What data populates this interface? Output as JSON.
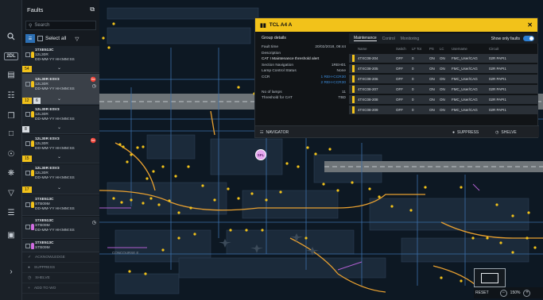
{
  "faults_panel": {
    "title": "Faults",
    "search_placeholder": "Search",
    "select_all_label": "Select all",
    "items": [
      {
        "title": "1TXE513C",
        "line2": "12L30R",
        "line3": "DD-MM-YY HH:MM:SS",
        "count": "54",
        "lamp": "#f2c21a"
      },
      {
        "title": "12L30R ESV3",
        "line2": "12L30R",
        "line3": "DD-MM-YY HH:MM:SS",
        "count": "12",
        "count2": "6",
        "lamp": "#f2c21a"
      },
      {
        "title": "12L30R ESV3",
        "line2": "12L30R",
        "line3": "DD-MM-YY HH:MM:SS",
        "count": "8",
        "lamp": "#f2c21a"
      },
      {
        "title": "12L30R ESV3",
        "line2": "12L30R",
        "line3": "DD-MM-YY HH:MM:SS",
        "count": "15",
        "lamp": "#f2c21a"
      },
      {
        "title": "12L30R ESV3",
        "line2": "12L30R",
        "line3": "DD-MM-YY HH:MM:SS",
        "count": "17",
        "lamp": "#f2c21a"
      },
      {
        "title": "1TXE513C",
        "line2": "STB09M",
        "line3": "DD-MM-YY HH:MM:SS",
        "lamp": "#f2c21a"
      },
      {
        "title": "1TXE513C",
        "line2": "STB09M",
        "line3": "DD-MM-YY HH:MM:SS",
        "lamp": "#d06be0"
      },
      {
        "title": "1TXE513C",
        "line2": "STB09M",
        "line3": "",
        "lamp": "#d06be0"
      }
    ],
    "actions": [
      "ACKNOWLEDGE",
      "SUPPRESS",
      "SHELVE",
      "ADD TO WO"
    ]
  },
  "popup": {
    "title": "TCL A4 A",
    "group_details_title": "Group details",
    "details": [
      {
        "label": "Fault time",
        "value": "20/02/2018, 09:44"
      },
      {
        "label": "Description",
        "value": ""
      },
      {
        "label": "CAT I Maintenance threshold alert",
        "value": ""
      },
      {
        "label": "Section Navigation",
        "value": "1REH01"
      },
      {
        "label": "Lamp Control Status",
        "value": "None"
      },
      {
        "label": "CCR",
        "value": "1 REH-CCR30"
      },
      {
        "label": "",
        "value": "2 REH-CCR30"
      },
      {
        "label": "No of lamps",
        "value": "11"
      },
      {
        "label": "Threshold for CAT",
        "value": "TBD"
      }
    ],
    "tabs": [
      "Maintenance",
      "Control",
      "Monitoring"
    ],
    "show_only_faults_label": "Show only faults",
    "columns": [
      "Name",
      "Switch",
      "LF Tot",
      "PS",
      "LC",
      "Username",
      "Circuit"
    ],
    "rows": [
      [
        "4TXC08-204",
        "OFF",
        "0",
        "ON",
        "ON",
        "FMC_User/CAG",
        "02R PAPI1"
      ],
      [
        "4TXC08-205",
        "OFF",
        "0",
        "ON",
        "ON",
        "FMC_User/CAG",
        "02R PAPI1"
      ],
      [
        "4TXC08-206",
        "OFF",
        "0",
        "ON",
        "ON",
        "FMC_User/CAG",
        "02R PAPI1"
      ],
      [
        "4TXC08-207",
        "OFF",
        "0",
        "ON",
        "ON",
        "FMC_User/CAG",
        "02R PAPI1"
      ],
      [
        "4TXC08-208",
        "OFF",
        "0",
        "ON",
        "ON",
        "FMC_User/CAG",
        "02R PAPI1"
      ],
      [
        "4TXC08-209",
        "OFF",
        "0",
        "ON",
        "ON",
        "FMC_User/CAG",
        "02R PAPI1"
      ]
    ],
    "navigator_label": "NAVIGATOR",
    "suppress_label": "SUPPRESS",
    "shelve_label": "SHELVE"
  },
  "map": {
    "marker_label": "SFL",
    "concourse_label": "CONCOURSE E",
    "reset_label": "RESET",
    "zoom_level": "150%"
  },
  "colors": {
    "accent": "#f2c21a",
    "blue": "#2c7fd4",
    "taxi": "#e8a030",
    "purple": "#d06be0"
  }
}
